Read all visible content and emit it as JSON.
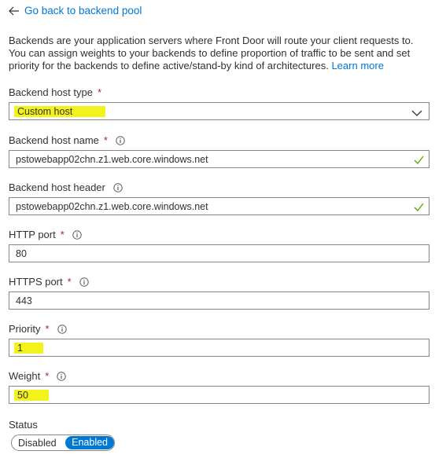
{
  "back_link": {
    "label": "Go back to backend pool"
  },
  "description": {
    "text": "Backends are your application servers where Front Door will route your client requests to. You can assign weights to your backends to define proportion of traffic to be sent and set priority for the backends to define active/stand-by kind of architectures.",
    "learn_more": "Learn more"
  },
  "fields": {
    "backend_host_type": {
      "label": "Backend host type",
      "required": "*",
      "value": "Custom host"
    },
    "backend_host_name": {
      "label": "Backend host name",
      "required": "*",
      "value": "pstowebapp02chn.z1.web.core.windows.net"
    },
    "backend_host_header": {
      "label": "Backend host header",
      "value": "pstowebapp02chn.z1.web.core.windows.net"
    },
    "http_port": {
      "label": "HTTP port",
      "required": "*",
      "value": "80"
    },
    "https_port": {
      "label": "HTTPS port",
      "required": "*",
      "value": "443"
    },
    "priority": {
      "label": "Priority",
      "required": "*",
      "value": "1"
    },
    "weight": {
      "label": "Weight",
      "required": "*",
      "value": "50"
    }
  },
  "status": {
    "label": "Status",
    "options": [
      "Disabled",
      "Enabled"
    ],
    "selected": "Enabled"
  },
  "colors": {
    "accent": "#0078d4",
    "required": "#a4262c",
    "highlight": "#f3f21b",
    "valid_check": "#57a300"
  },
  "icons": [
    "arrow-left-icon",
    "info-icon",
    "checkmark-icon",
    "chevron-down-icon"
  ]
}
